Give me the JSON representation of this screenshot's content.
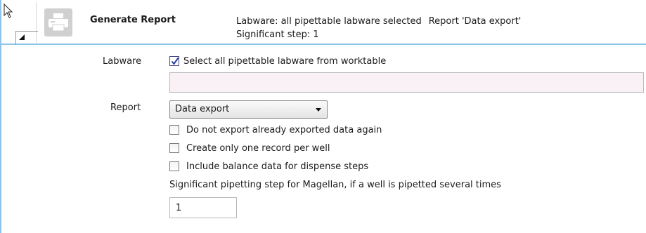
{
  "step": {
    "title": "Generate Report",
    "summary_line1_labware": "Labware: all pipettable labware selected",
    "summary_line1_report": "Report 'Data export'",
    "summary_line2": "Significant step: 1",
    "icon": "printer-icon",
    "accent_color": "#8cc4ea"
  },
  "form": {
    "labware_label": "Labware",
    "select_all_label": "Select all pipettable labware from worktable",
    "select_all_checked": true,
    "labware_value": "",
    "report_label": "Report",
    "report_value": "Data export",
    "options": [
      {
        "label": "Do not export already exported data again",
        "checked": false
      },
      {
        "label": "Create only one record per well",
        "checked": false
      },
      {
        "label": "Include balance data for dispense steps",
        "checked": false
      }
    ],
    "significant_step_label": "Significant pipetting step for Magellan, if a well is pipetted several times",
    "significant_step_value": "1"
  }
}
